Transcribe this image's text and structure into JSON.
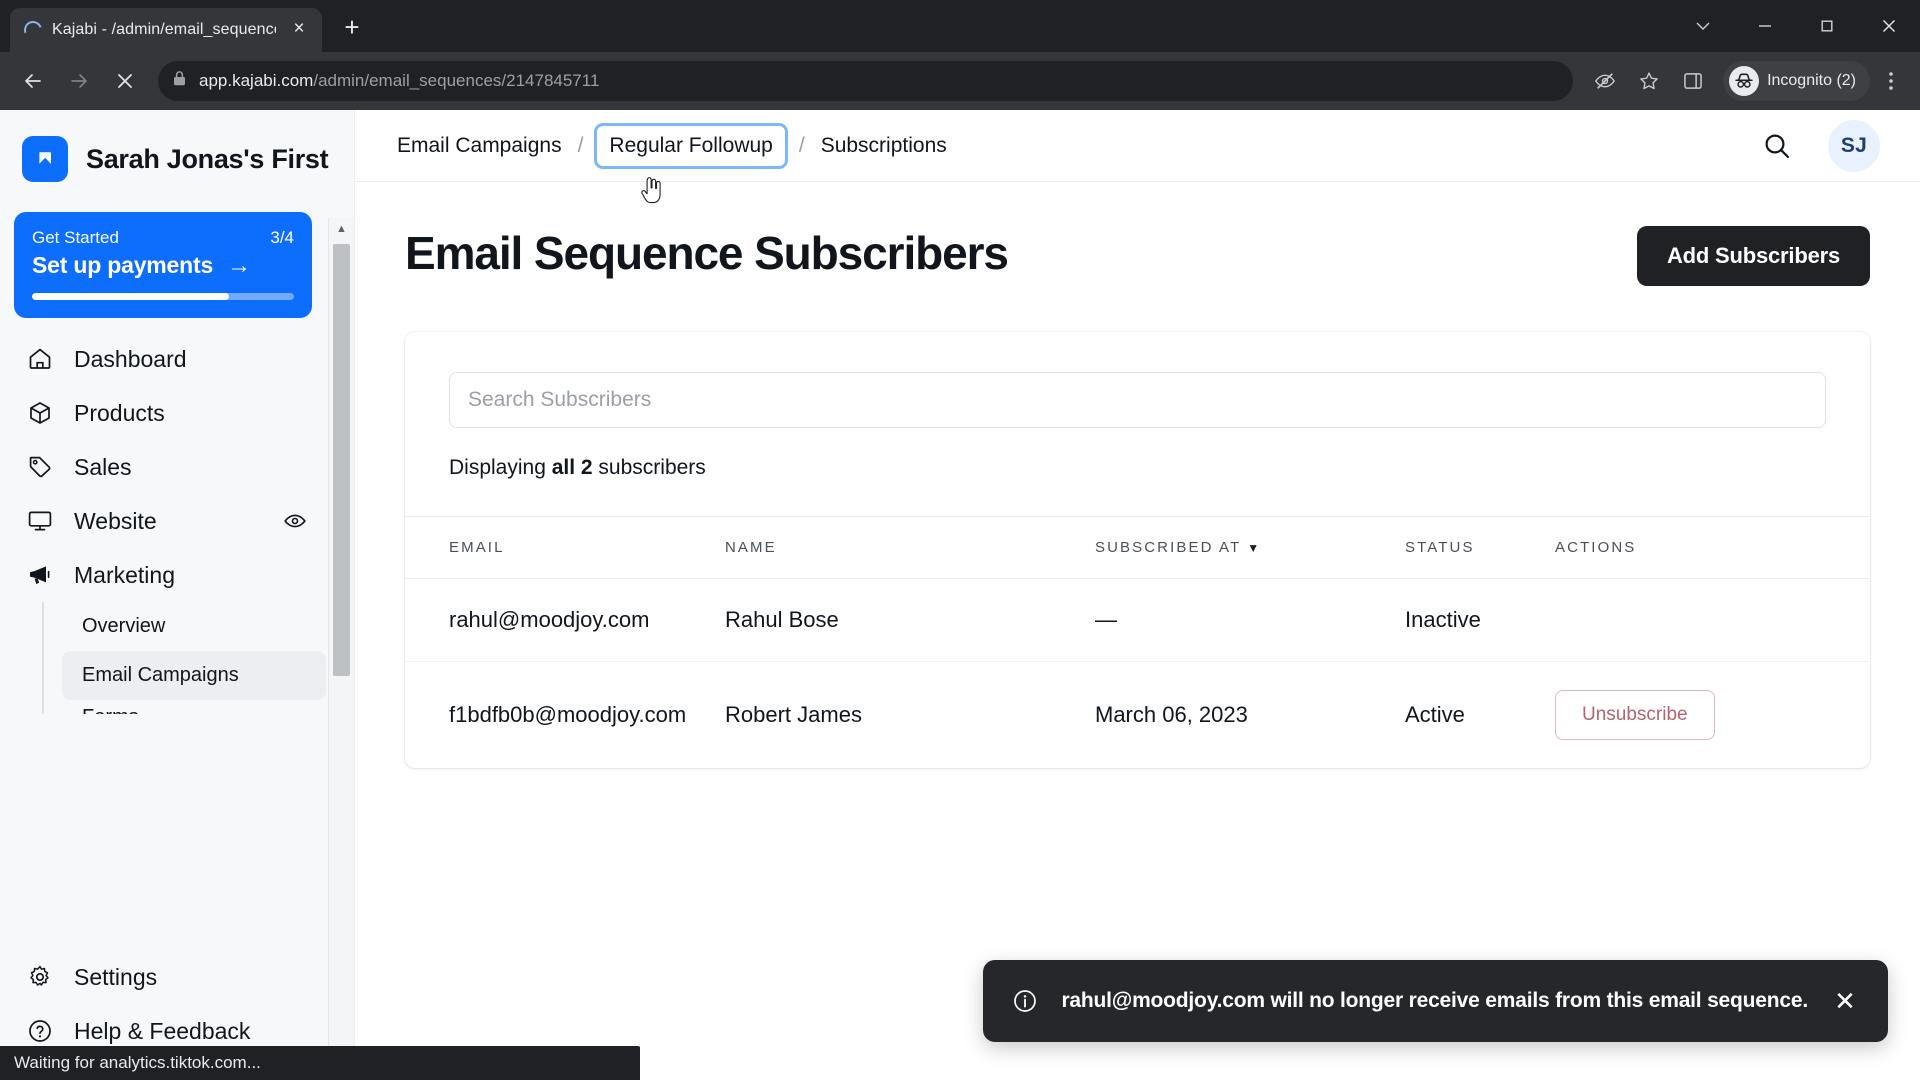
{
  "browser": {
    "tab": {
      "title": "Kajabi - /admin/email_sequences",
      "close_label": "×",
      "spinner": "loading-spinner"
    },
    "new_tab_label": "+",
    "window_controls": {
      "minimize": "—",
      "maximize": "❐",
      "close": "✕",
      "chevron": "∨"
    },
    "nav": {
      "back": "←",
      "forward": "→",
      "stop": "✕"
    },
    "url": {
      "domain": "app.kajabi.com",
      "path": "/admin/email_sequences/2147845711",
      "lock_icon": "lock-icon"
    },
    "omni_icons": {
      "no_tracking": "eye-slash-icon",
      "bookmark": "star-icon",
      "side_panel": "side-panel-icon"
    },
    "profile": {
      "label": "Incognito (2)",
      "icon": "incognito-icon"
    },
    "menu_icon": "kebab-menu-icon",
    "status_text": "Waiting for analytics.tiktok.com..."
  },
  "sidebar": {
    "brand": {
      "name": "Sarah Jonas's First",
      "logo_icon": "kajabi-logo-icon"
    },
    "get_started": {
      "label": "Get Started",
      "count": "3/4",
      "title": "Set up payments",
      "arrow": "→",
      "progress_percent": 75,
      "accent": "#0d6efd"
    },
    "items": [
      {
        "label": "Dashboard",
        "icon": "home-icon"
      },
      {
        "label": "Products",
        "icon": "box-icon"
      },
      {
        "label": "Sales",
        "icon": "tag-icon"
      },
      {
        "label": "Website",
        "icon": "monitor-icon",
        "trailing_icon": "eye-icon"
      },
      {
        "label": "Marketing",
        "icon": "megaphone-icon"
      }
    ],
    "sub_items": [
      {
        "label": "Overview",
        "active": false
      },
      {
        "label": "Email Campaigns",
        "active": true
      },
      {
        "label": "Forms",
        "active": false,
        "clipped": true
      }
    ],
    "bottom_items": [
      {
        "label": "Settings",
        "icon": "gear-icon"
      },
      {
        "label": "Help & Feedback",
        "icon": "question-circle-icon"
      }
    ],
    "scrollbar": {
      "up_arrow": "▲",
      "down_arrow": "▼"
    }
  },
  "topbar": {
    "breadcrumbs": [
      {
        "label": "Email Campaigns",
        "focused": false
      },
      {
        "label": "Regular Followup",
        "focused": true
      },
      {
        "label": "Subscriptions",
        "focused": false
      }
    ],
    "separator": "/",
    "search_icon": "search-icon",
    "avatar_initials": "SJ",
    "focus_ring_color": "#7cb8f7"
  },
  "main": {
    "title": "Email Sequence Subscribers",
    "add_button": "Add Subscribers",
    "search": {
      "placeholder": "Search Subscribers",
      "value": ""
    },
    "displaying": {
      "prefix": "Displaying ",
      "strong": "all 2",
      "suffix": " subscribers"
    },
    "table": {
      "columns": [
        "EMAIL",
        "NAME",
        "SUBSCRIBED AT",
        "STATUS",
        "ACTIONS"
      ],
      "sort_column": "SUBSCRIBED AT",
      "sort_caret": "▼",
      "rows": [
        {
          "email": "rahul@moodjoy.com",
          "name": "Rahul Bose",
          "subscribed_at": "—",
          "status": "Inactive",
          "action": ""
        },
        {
          "email": "f1bdfb0b@moodjoy.com",
          "name": "Robert James",
          "subscribed_at": "March 06, 2023",
          "status": "Active",
          "action": "Unsubscribe"
        }
      ]
    }
  },
  "toast": {
    "icon": "info-circle-icon",
    "message": "rahul@moodjoy.com will no longer receive emails from this email sequence.",
    "close": "✕",
    "background": "#25272b"
  }
}
